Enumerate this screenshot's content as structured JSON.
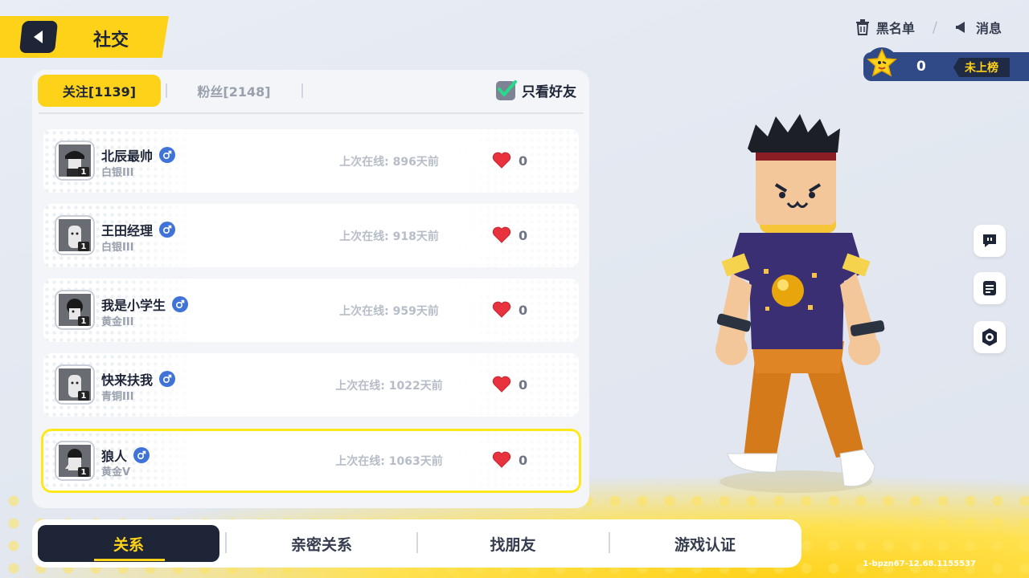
{
  "header": {
    "title": "社交",
    "blacklist_label": "黑名单",
    "separator": "/",
    "messages_label": "消息"
  },
  "rank_badge": {
    "score": "0",
    "status": "未上榜"
  },
  "tabs": {
    "following": "关注[1139]",
    "fans": "粉丝[2148]",
    "friends_only": "只看好友",
    "friends_only_checked": true
  },
  "friends": [
    {
      "name": "北辰最帅",
      "rank": "白银III",
      "last_online": "上次在线: 896天前",
      "likes": "0",
      "level": "1"
    },
    {
      "name": "王田经理",
      "rank": "白银III",
      "last_online": "上次在线: 918天前",
      "likes": "0",
      "level": "1"
    },
    {
      "name": "我是小学生",
      "rank": "黄金III",
      "last_online": "上次在线: 959天前",
      "likes": "0",
      "level": "1"
    },
    {
      "name": "快来扶我",
      "rank": "青铜III",
      "last_online": "上次在线: 1022天前",
      "likes": "0",
      "level": "1"
    },
    {
      "name": "狼人",
      "rank": "黄金V",
      "last_online": "上次在线: 1063天前",
      "likes": "0",
      "level": "1"
    }
  ],
  "bottom_nav": [
    "关系",
    "亲密关系",
    "找朋友",
    "游戏认证"
  ],
  "version": "1-bpzn67-12.68.1155537",
  "colors": {
    "accent": "#ffd21a",
    "dark": "#1e2537",
    "male": "#3f73d8",
    "heart": "#e8333f"
  }
}
